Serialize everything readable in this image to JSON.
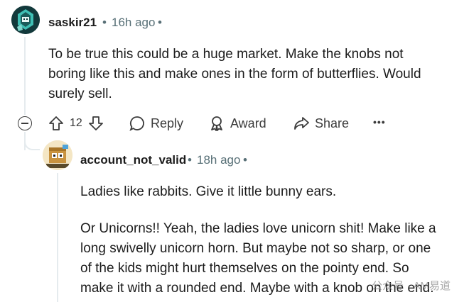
{
  "comment1": {
    "username": "saskir21",
    "time": "16h ago",
    "lines": [
      "To be true this could be a huge market. Make the knobs not",
      "boring like this and make ones in the form of butterflies. Would",
      "surely sell."
    ],
    "vote_count": "12",
    "actions": {
      "reply": "Reply",
      "award": "Award",
      "share": "Share",
      "more": "•••"
    }
  },
  "comment2": {
    "username": "account_not_valid",
    "time": "18h ago",
    "paragraph1": "Ladies like rabbits. Give it little bunny ears.",
    "paragraph2_lines": [
      "Or Unicorns!! Yeah, the ladies love unicorn shit! Make like a",
      "long swivelly unicorn horn. But maybe not so sharp, or one",
      "of the kids might hurt themselves on the pointy end. So",
      "make it with a rounded end. Maybe with a knob on the end."
    ]
  },
  "separator": "•",
  "watermark": "公众号 · AM易道",
  "colors": {
    "accent": "#1c1c1c",
    "meta": "#576f76",
    "thread": "#e5ebee"
  },
  "icons": [
    "avatar-robot-icon",
    "upvote-icon",
    "downvote-icon",
    "reply-icon",
    "award-icon",
    "share-icon",
    "collapse-icon",
    "avatar-cardboard-icon"
  ]
}
